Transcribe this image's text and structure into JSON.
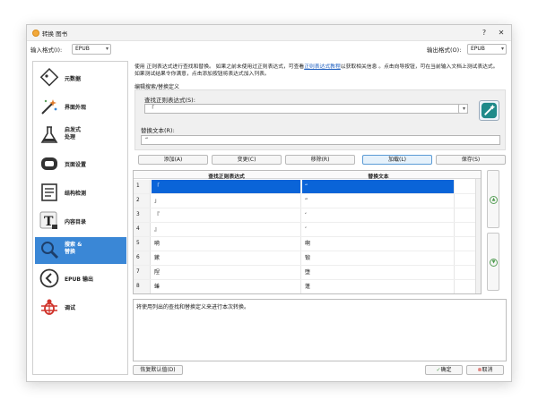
{
  "window": {
    "title": "转换 图书",
    "help": "?",
    "close": "✕"
  },
  "formats": {
    "input_label": "输入格式(I):",
    "input_value": "EPUB",
    "output_label": "输出格式(O):",
    "output_value": "EPUB"
  },
  "sidebar": {
    "items": [
      {
        "label": "元数据",
        "icon": "metadata-icon"
      },
      {
        "label": "界面外观",
        "icon": "look-and-feel-icon"
      },
      {
        "label": "启发式\n处理",
        "icon": "heuristics-icon"
      },
      {
        "label": "页面设置",
        "icon": "page-setup-icon"
      },
      {
        "label": "结构检测",
        "icon": "structure-icon"
      },
      {
        "label": "内容目录",
        "icon": "toc-icon"
      },
      {
        "label": "搜索 &\n替换",
        "icon": "search-replace-icon"
      },
      {
        "label": "EPUB 输出",
        "icon": "epub-output-icon"
      },
      {
        "label": "调试",
        "icon": "debug-icon"
      }
    ]
  },
  "main": {
    "desc_part1": "使用 正则表达式进行查找和替换。 如果之前未使用过正则表达式，可查看",
    "desc_link": "正则表达式教程",
    "desc_part2": "以获取相关信息 。点击向导按钮，可在当前输入文档上测试表达式。 如果测试结果令你满意，点击添加按钮将表达式加入列表。",
    "section_label": "编辑搜索/替换定义",
    "regex_label": "查找正则表达式(S):",
    "regex_value": "「",
    "replace_label": "替换文本(R):",
    "replace_value": "“"
  },
  "buttons": {
    "add": "添加(A)",
    "change": "变更(C)",
    "remove": "移除(R)",
    "load": "加载(L)",
    "save": "保存(S)",
    "reset": "恢复默认值(D)",
    "ok": "确定",
    "cancel": "取消"
  },
  "table": {
    "headers": [
      "查找正则表达式",
      "替换文本"
    ],
    "rows": [
      {
        "n": "1",
        "find": "「",
        "repl": "“"
      },
      {
        "n": "2",
        "find": "」",
        "repl": "”"
      },
      {
        "n": "3",
        "find": "『",
        "repl": "‘"
      },
      {
        "n": "4",
        "find": "』",
        "repl": "’"
      },
      {
        "n": "5",
        "find": "嗬",
        "repl": "啊"
      },
      {
        "n": "6",
        "find": "鏉",
        "repl": "锻"
      },
      {
        "n": "7",
        "find": "陧",
        "repl": "堕"
      },
      {
        "n": "8",
        "find": "蝽",
        "repl": "蓬"
      }
    ]
  },
  "result_text": "将使用列出的查找和替换定义来进行本次转换。"
}
